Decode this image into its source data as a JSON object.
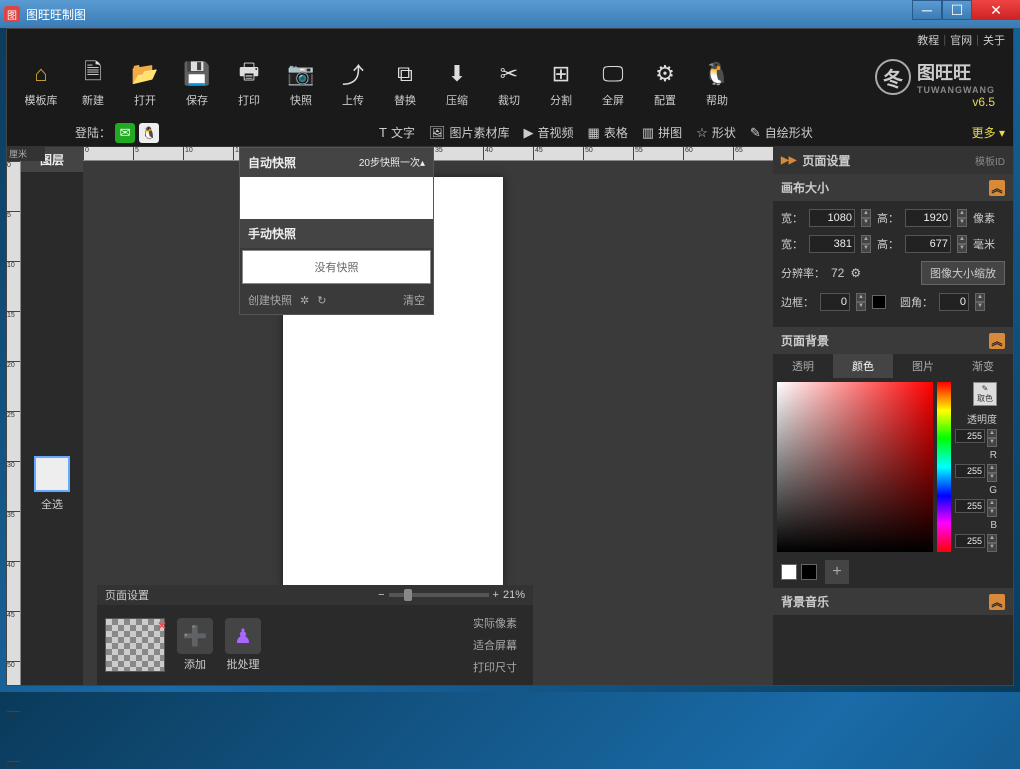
{
  "window": {
    "title": "图旺旺制图",
    "app_icon_char": "图"
  },
  "topnav": {
    "tutorial": "教程",
    "official": "官网",
    "about": "关于"
  },
  "toolbar": [
    {
      "id": "template-lib",
      "label": "模板库",
      "glyph": "⌂"
    },
    {
      "id": "new",
      "label": "新建",
      "glyph": "🗎"
    },
    {
      "id": "open",
      "label": "打开",
      "glyph": "📂"
    },
    {
      "id": "save",
      "label": "保存",
      "glyph": "💾"
    },
    {
      "id": "print",
      "label": "打印",
      "glyph": "🖶"
    },
    {
      "id": "snapshot",
      "label": "快照",
      "glyph": "📷"
    },
    {
      "id": "upload",
      "label": "上传",
      "glyph": "⤴"
    },
    {
      "id": "replace",
      "label": "替换",
      "glyph": "⧉"
    },
    {
      "id": "compress",
      "label": "压缩",
      "glyph": "⬇"
    },
    {
      "id": "cut",
      "label": "裁切",
      "glyph": "✂"
    },
    {
      "id": "split",
      "label": "分割",
      "glyph": "⊞"
    },
    {
      "id": "fullscreen",
      "label": "全屏",
      "glyph": "🖵"
    },
    {
      "id": "config",
      "label": "配置",
      "glyph": "⚙"
    },
    {
      "id": "help",
      "label": "帮助",
      "glyph": "🐧"
    }
  ],
  "brand": {
    "name": "图旺旺",
    "sub": "TUWANGWANG",
    "version": "v6.5",
    "circle_char": "冬"
  },
  "login": {
    "label": "登陆："
  },
  "toolbar2": [
    {
      "id": "text",
      "label": "文字",
      "glyph": "T"
    },
    {
      "id": "image-lib",
      "label": "图片素材库",
      "glyph": "🖼"
    },
    {
      "id": "audio-video",
      "label": "音视频",
      "glyph": "▶"
    },
    {
      "id": "table",
      "label": "表格",
      "glyph": "▦"
    },
    {
      "id": "puzzle",
      "label": "拼图",
      "glyph": "▥"
    },
    {
      "id": "shape",
      "label": "形状",
      "glyph": "☆"
    },
    {
      "id": "freehand",
      "label": "自绘形状",
      "glyph": "✎"
    }
  ],
  "more": "更多 ▾",
  "ruler_unit": "厘米",
  "layers": {
    "header": "图层",
    "select_all": "全选"
  },
  "snapshot_popup": {
    "auto_header": "自动快照",
    "auto_setting": "20步快照一次▴",
    "manual_header": "手动快照",
    "empty_text": "没有快照",
    "create": "创建快照",
    "clear": "清空"
  },
  "right_panel": {
    "header": "页面设置",
    "template_id": "模板ID",
    "canvas_size": {
      "title": "画布大小",
      "width_label": "宽：",
      "height_label": "高：",
      "width_px": "1080",
      "height_px": "1920",
      "unit_px": "像素",
      "width_mm": "381",
      "height_mm": "677",
      "unit_mm": "毫米",
      "dpi_label": "分辨率：",
      "dpi": "72",
      "scale_btn": "图像大小缩放",
      "border_label": "边框：",
      "border_val": "0",
      "radius_label": "圆角：",
      "radius_val": "0"
    },
    "background": {
      "title": "页面背景",
      "tabs": {
        "transparent": "透明",
        "color": "颜色",
        "image": "图片",
        "gradient": "渐变"
      },
      "picker_label": "取色",
      "opacity_label": "透明度",
      "opacity": "255",
      "r_label": "R",
      "r": "255",
      "g_label": "G",
      "g": "255",
      "b_label": "B",
      "b": "255",
      "swatches": [
        "#ffffff",
        "#000000"
      ]
    },
    "music": {
      "title": "背景音乐"
    }
  },
  "bottom": {
    "page_settings": "页面设置",
    "zoom_pct": "21%",
    "add": "添加",
    "batch": "批处理",
    "view_modes": [
      "实际像素",
      "适合屏幕",
      "打印尺寸"
    ]
  }
}
